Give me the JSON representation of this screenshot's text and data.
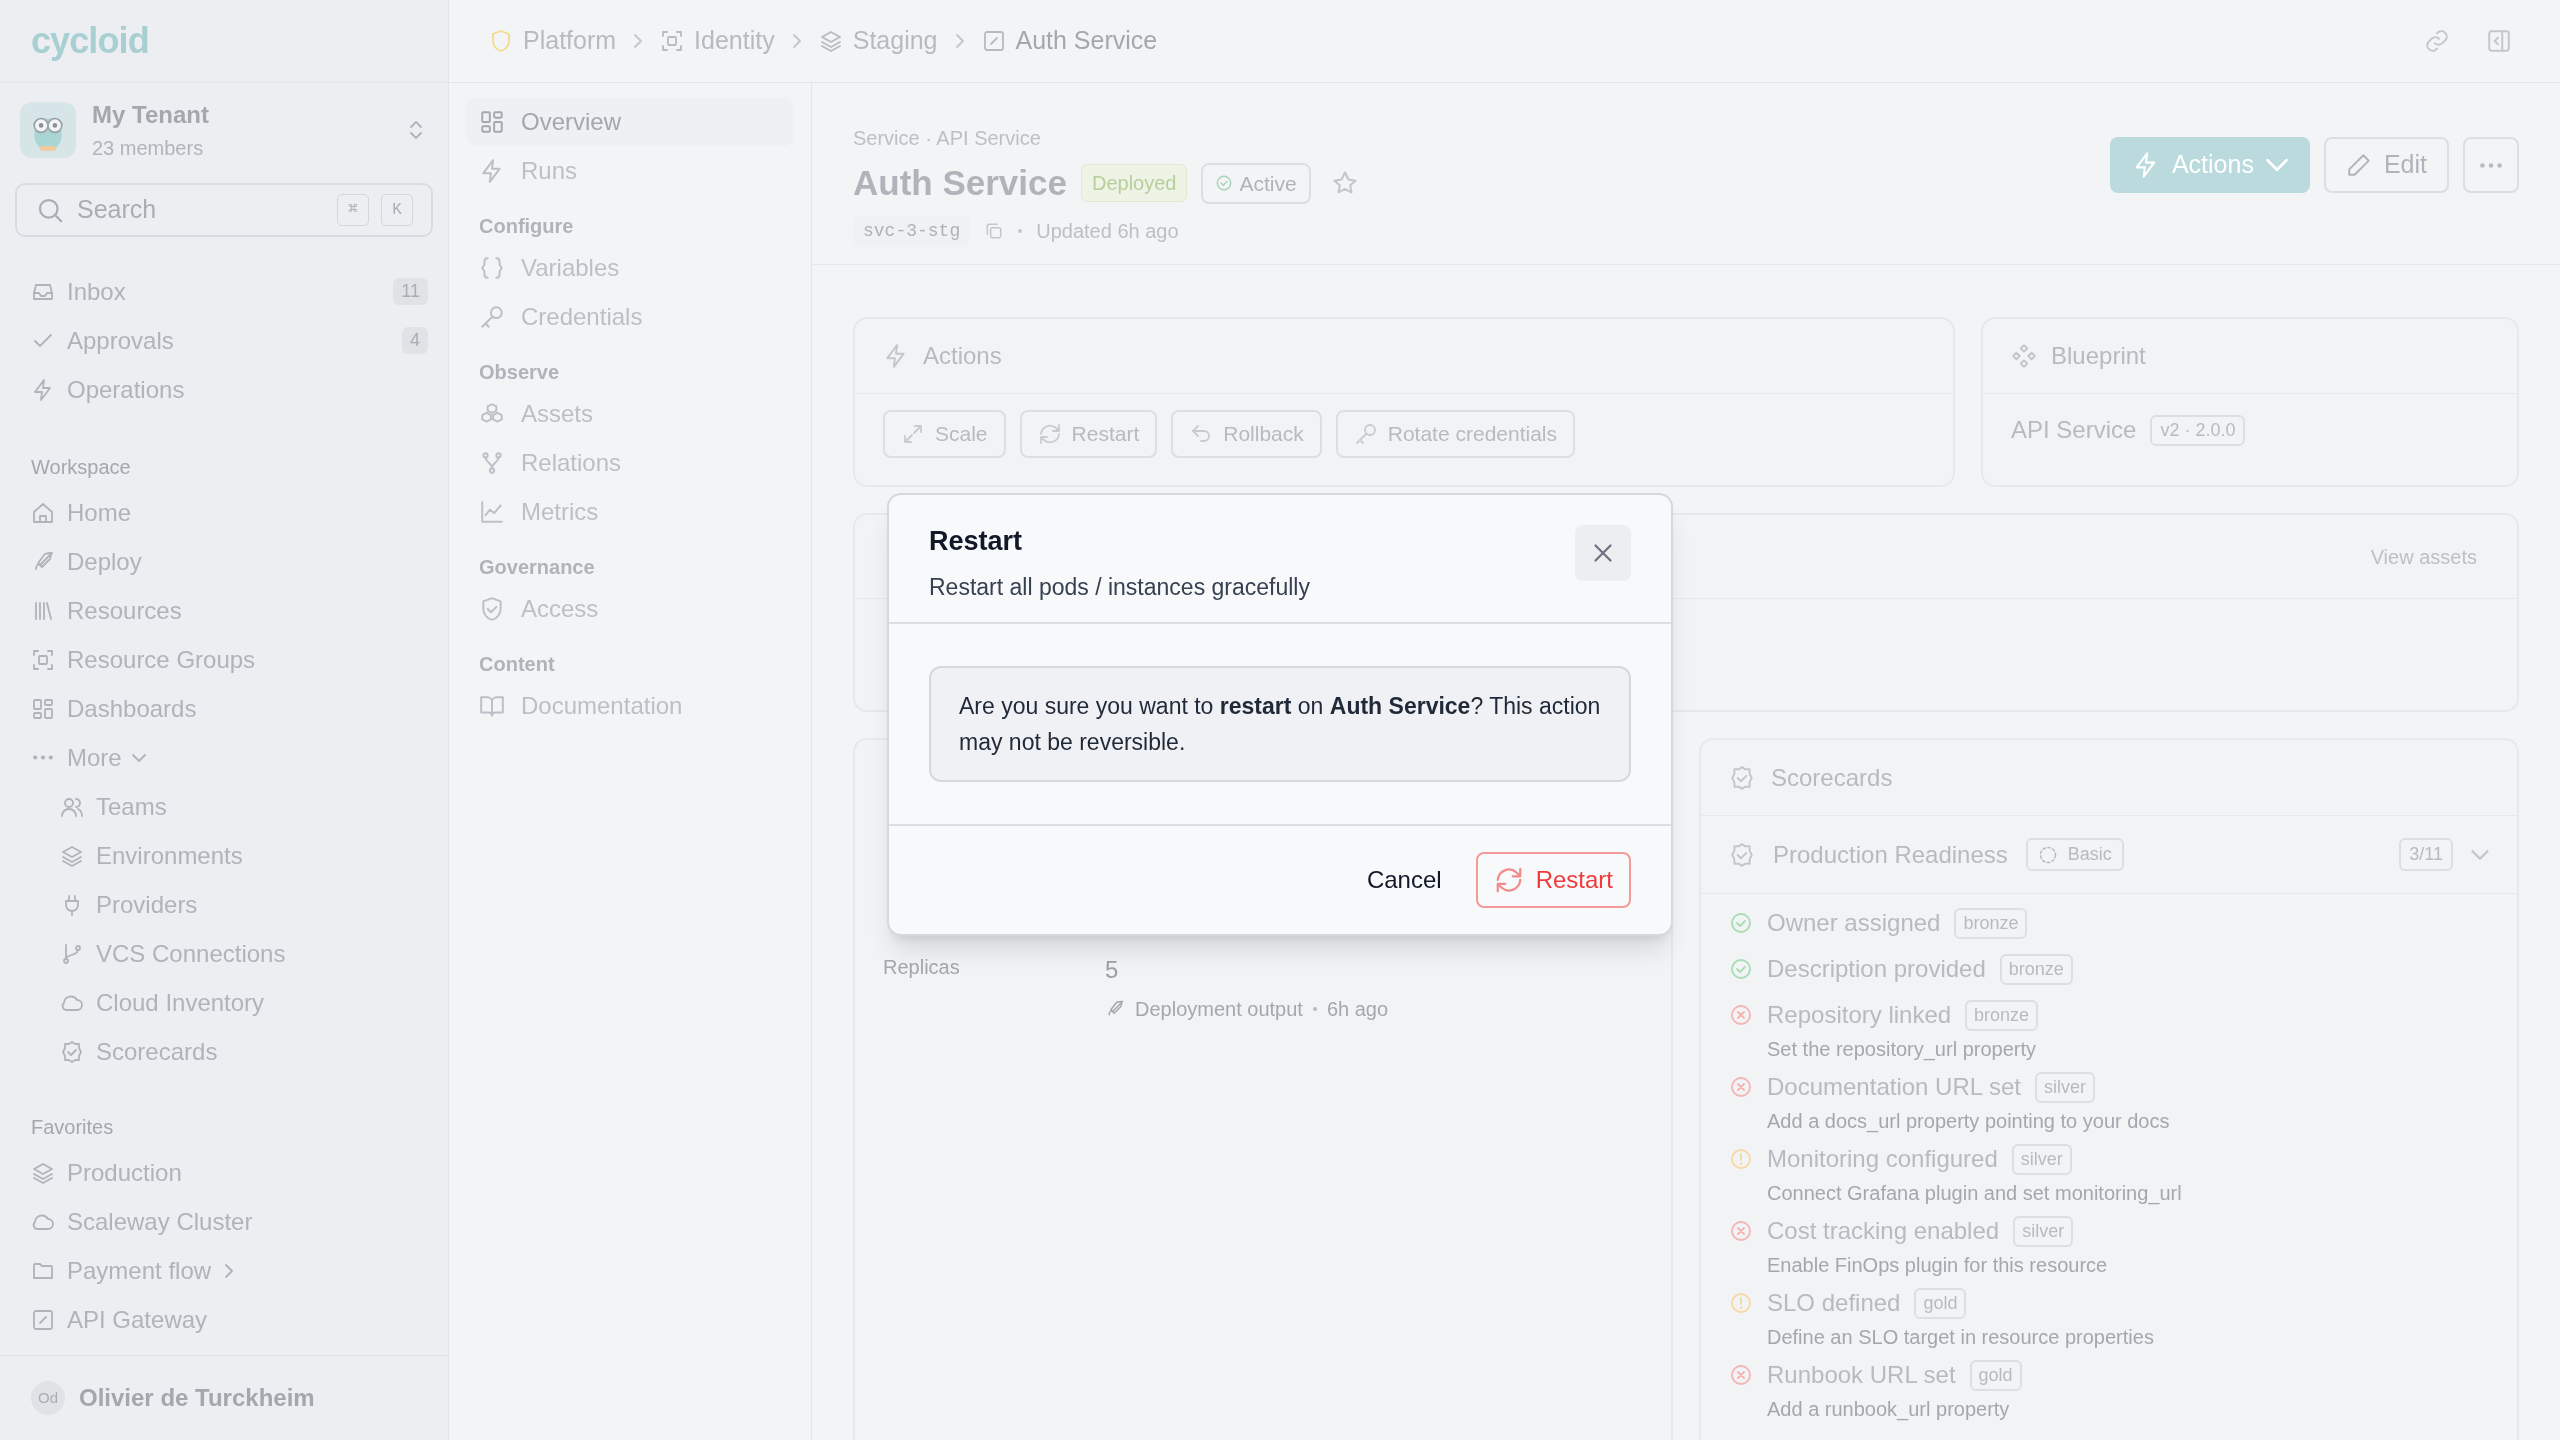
{
  "sidebar": {
    "logo": "cycloid",
    "tenant": {
      "name": "My Tenant",
      "members": "23 members"
    },
    "search": {
      "placeholder": "Search",
      "keys": [
        "⌘",
        "K"
      ]
    },
    "top_items": [
      {
        "label": "Inbox",
        "count": "11"
      },
      {
        "label": "Approvals",
        "count": "4"
      },
      {
        "label": "Operations"
      }
    ],
    "workspace": {
      "heading": "Workspace",
      "items": [
        {
          "label": "Home"
        },
        {
          "label": "Deploy"
        },
        {
          "label": "Resources"
        },
        {
          "label": "Resource Groups"
        },
        {
          "label": "Dashboards"
        },
        {
          "label": "More",
          "expanded": true,
          "children": [
            {
              "label": "Teams"
            },
            {
              "label": "Environments"
            },
            {
              "label": "Providers"
            },
            {
              "label": "VCS Connections"
            },
            {
              "label": "Cloud Inventory"
            },
            {
              "label": "Scorecards"
            }
          ]
        }
      ]
    },
    "favorites": {
      "heading": "Favorites",
      "items": [
        {
          "label": "Production",
          "expandable": false
        },
        {
          "label": "Scaleway Cluster",
          "expandable": false
        },
        {
          "label": "Payment flow",
          "expandable": true
        },
        {
          "label": "API Gateway",
          "expandable": false
        }
      ]
    },
    "user": {
      "initials": "Od",
      "name": "Olivier de Turckheim"
    }
  },
  "breadcrumbs": [
    {
      "label": "Platform"
    },
    {
      "label": "Identity"
    },
    {
      "label": "Staging"
    },
    {
      "label": "Auth Service"
    }
  ],
  "subnav": {
    "items": [
      {
        "label": "Overview",
        "selected": true
      },
      {
        "label": "Runs",
        "selected": false
      }
    ],
    "sections": [
      {
        "heading": "Configure",
        "items": [
          {
            "label": "Variables",
            "selected": false
          },
          {
            "label": "Credentials",
            "selected": false
          }
        ]
      },
      {
        "heading": "Observe",
        "items": [
          {
            "label": "Assets",
            "selected": false
          },
          {
            "label": "Relations",
            "selected": false
          },
          {
            "label": "Metrics",
            "selected": false
          }
        ]
      },
      {
        "heading": "Governance",
        "items": [
          {
            "label": "Access",
            "selected": false
          }
        ]
      },
      {
        "heading": "Content",
        "items": [
          {
            "label": "Documentation",
            "selected": false
          }
        ]
      }
    ]
  },
  "header": {
    "kind": "Service · API Service",
    "title": "Auth Service",
    "badges": [
      "Deployed",
      "Active"
    ],
    "id": "svc-3-stg",
    "updated": "Updated 6h ago",
    "buttons": [
      "Actions",
      "Edit"
    ]
  },
  "actions_card": {
    "title": "Actions",
    "buttons": [
      "Scale",
      "Restart",
      "Rollback",
      "Rotate credentials"
    ]
  },
  "blueprint_card": {
    "title": "Blueprint",
    "name": "API Service",
    "version": "v2 · 2.0.0"
  },
  "assets_card": {
    "link": "View assets"
  },
  "details_card": {
    "rows": [
      {
        "label": "Replicas",
        "value": "5",
        "source": "Deployment output",
        "time": "6h ago"
      }
    ]
  },
  "scorecards": {
    "title": "Scorecards",
    "scorecard": {
      "name": "Production Readiness",
      "level": "Basic",
      "score": "3/11",
      "expanded": true
    },
    "checks": [
      {
        "kind": "pass",
        "name": "Owner assigned",
        "tier": "bronze"
      },
      {
        "kind": "pass",
        "name": "Description provided",
        "tier": "bronze"
      },
      {
        "kind": "fail",
        "name": "Repository linked",
        "tier": "bronze",
        "hint": "Set the repository_url property"
      },
      {
        "kind": "fail",
        "name": "Documentation URL set",
        "tier": "silver",
        "hint": "Add a docs_url property pointing to your docs"
      },
      {
        "kind": "warn",
        "name": "Monitoring configured",
        "tier": "silver",
        "hint": "Connect Grafana plugin and set monitoring_url"
      },
      {
        "kind": "fail",
        "name": "Cost tracking enabled",
        "tier": "silver",
        "hint": "Enable FinOps plugin for this resource"
      },
      {
        "kind": "warn",
        "name": "SLO defined",
        "tier": "gold",
        "hint": "Define an SLO target in resource properties"
      },
      {
        "kind": "fail",
        "name": "Runbook URL set",
        "tier": "gold",
        "hint": "Add a runbook_url property"
      }
    ]
  },
  "modal": {
    "title": "Restart",
    "subtitle": "Restart all pods / instances gracefully",
    "message": "Are you sure you want to **restart** on **Auth Service**? This action may not be reversible.",
    "cancel": "Cancel",
    "confirm": "Restart"
  }
}
